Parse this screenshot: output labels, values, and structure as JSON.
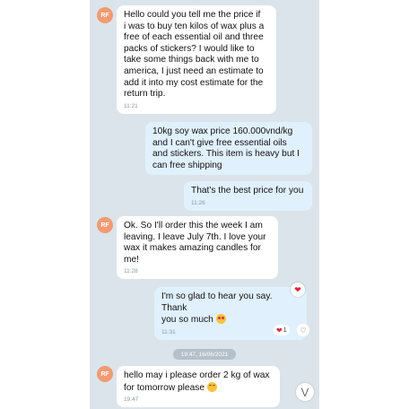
{
  "avatar_initials": "RF",
  "messages": [
    {
      "direction": "in",
      "text": "Hello could you tell me the price if\ni was to buy ten kilos of wax plus a\nfree of each essential oil and three\npacks of stickers? I would like to\ntake some things back with me to\namerica, I just need an estimate to\nadd it into my cost estimate for the\nreturn trip.",
      "time": "11:21"
    },
    {
      "direction": "out",
      "text": "10kg soy wax price 160.000vnd/kg\nand I can't give free essential oils\nand stickers. This item is heavy but I\ncan free shipping",
      "time": ""
    },
    {
      "direction": "out",
      "text": "That's the best price for you",
      "time": "11:26"
    },
    {
      "direction": "in",
      "text": "Ok. So I'll order this the week I am\nleaving. I leave July 7th.  I love your\nwax it makes amazing candles for\nme!",
      "time": "11:28"
    },
    {
      "direction": "out",
      "text_line1": "I'm so glad to hear you say. Thank",
      "text_line2": "you so much",
      "emoji": "heart-eyes-emoji",
      "time": "11:31",
      "reaction_count": "1"
    },
    {
      "direction": "in",
      "text_line1": "hello may i please order 2 kg of wax",
      "text_line2": "for tomorrow please",
      "emoji": "smiling-emoji",
      "time": "19:47"
    }
  ],
  "date_separator": "19:47, 16/06/2021",
  "icons": {
    "reaction": "heart-icon",
    "add_reaction": "heart-outline-icon",
    "scroll_down": "chevron-double-down-icon"
  },
  "colors": {
    "chat_background": "#dbe4ea",
    "incoming_bubble": "#ffffff",
    "outgoing_bubble": "#e0f1fd",
    "avatar": "#f39a72",
    "heart": "#e0243b"
  }
}
